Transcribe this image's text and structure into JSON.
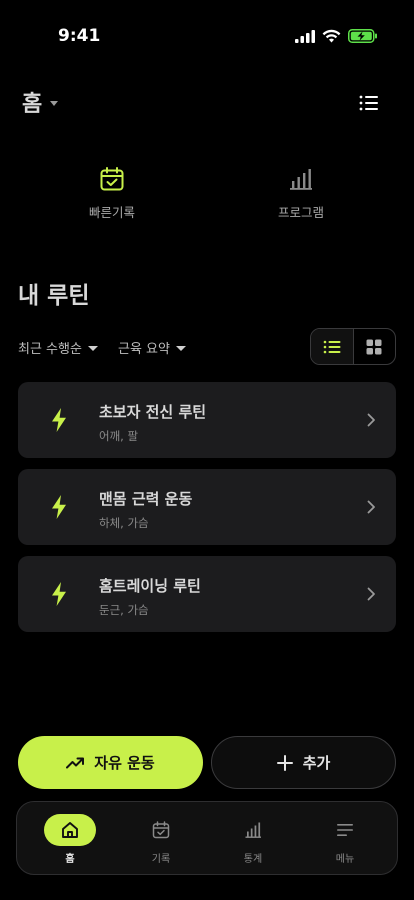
{
  "status_bar": {
    "time": "9:41"
  },
  "header": {
    "title": "홈"
  },
  "quick_actions": [
    {
      "label": "빠른기록",
      "icon": "calendar-check-icon"
    },
    {
      "label": "프로그램",
      "icon": "bar-chart-icon"
    }
  ],
  "section": {
    "title": "내 루틴"
  },
  "filters": {
    "sort_label": "최근 수행순",
    "group_label": "근육 요약"
  },
  "routines": [
    {
      "name": "초보자 전신 루틴",
      "muscles": "어깨, 팔"
    },
    {
      "name": "맨몸 근력 운동",
      "muscles": "하체, 가슴"
    },
    {
      "name": "홈트레이닝 루틴",
      "muscles": "둔근, 가슴"
    }
  ],
  "actions": {
    "free_workout_label": "자유 운동",
    "add_label": "추가"
  },
  "tabs": [
    {
      "label": "홈",
      "icon": "home-icon",
      "active": true
    },
    {
      "label": "기록",
      "icon": "calendar-check-icon",
      "active": false
    },
    {
      "label": "통계",
      "icon": "bar-chart-icon",
      "active": false
    },
    {
      "label": "메뉴",
      "icon": "menu-lines-icon",
      "active": false
    }
  ],
  "colors": {
    "accent": "#c8f04a",
    "card": "#1c1c1e",
    "background": "#000000"
  }
}
